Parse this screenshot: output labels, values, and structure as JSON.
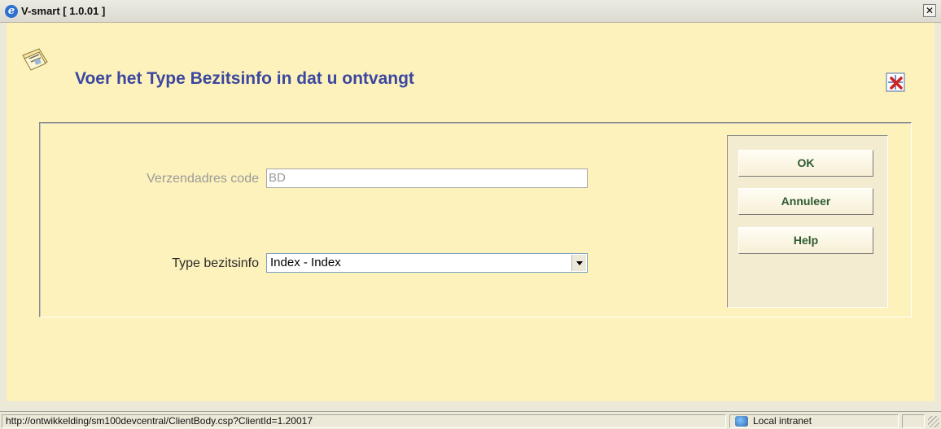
{
  "window": {
    "title": "V-smart [ 1.0.01 ]",
    "close_glyph": "✕"
  },
  "page": {
    "title": "Voer het Type Bezitsinfo in dat u ontvangt",
    "icon": "newspaper-icon",
    "exit_icon": "exit-icon"
  },
  "form": {
    "address_label": "Verzendadres code",
    "address_value": "BD",
    "type_label": "Type bezitsinfo",
    "type_selected": "Index - Index"
  },
  "buttons": {
    "ok": "OK",
    "cancel": "Annuleer",
    "help": "Help"
  },
  "statusbar": {
    "url": "http://ontwikkelding/sm100devcentral/ClientBody.csp?ClientId=1.20017",
    "zone": "Local intranet"
  },
  "colors": {
    "content_bg": "#fdf2bb",
    "title_blue": "#3b47a0",
    "button_text": "#2e5a2e"
  }
}
